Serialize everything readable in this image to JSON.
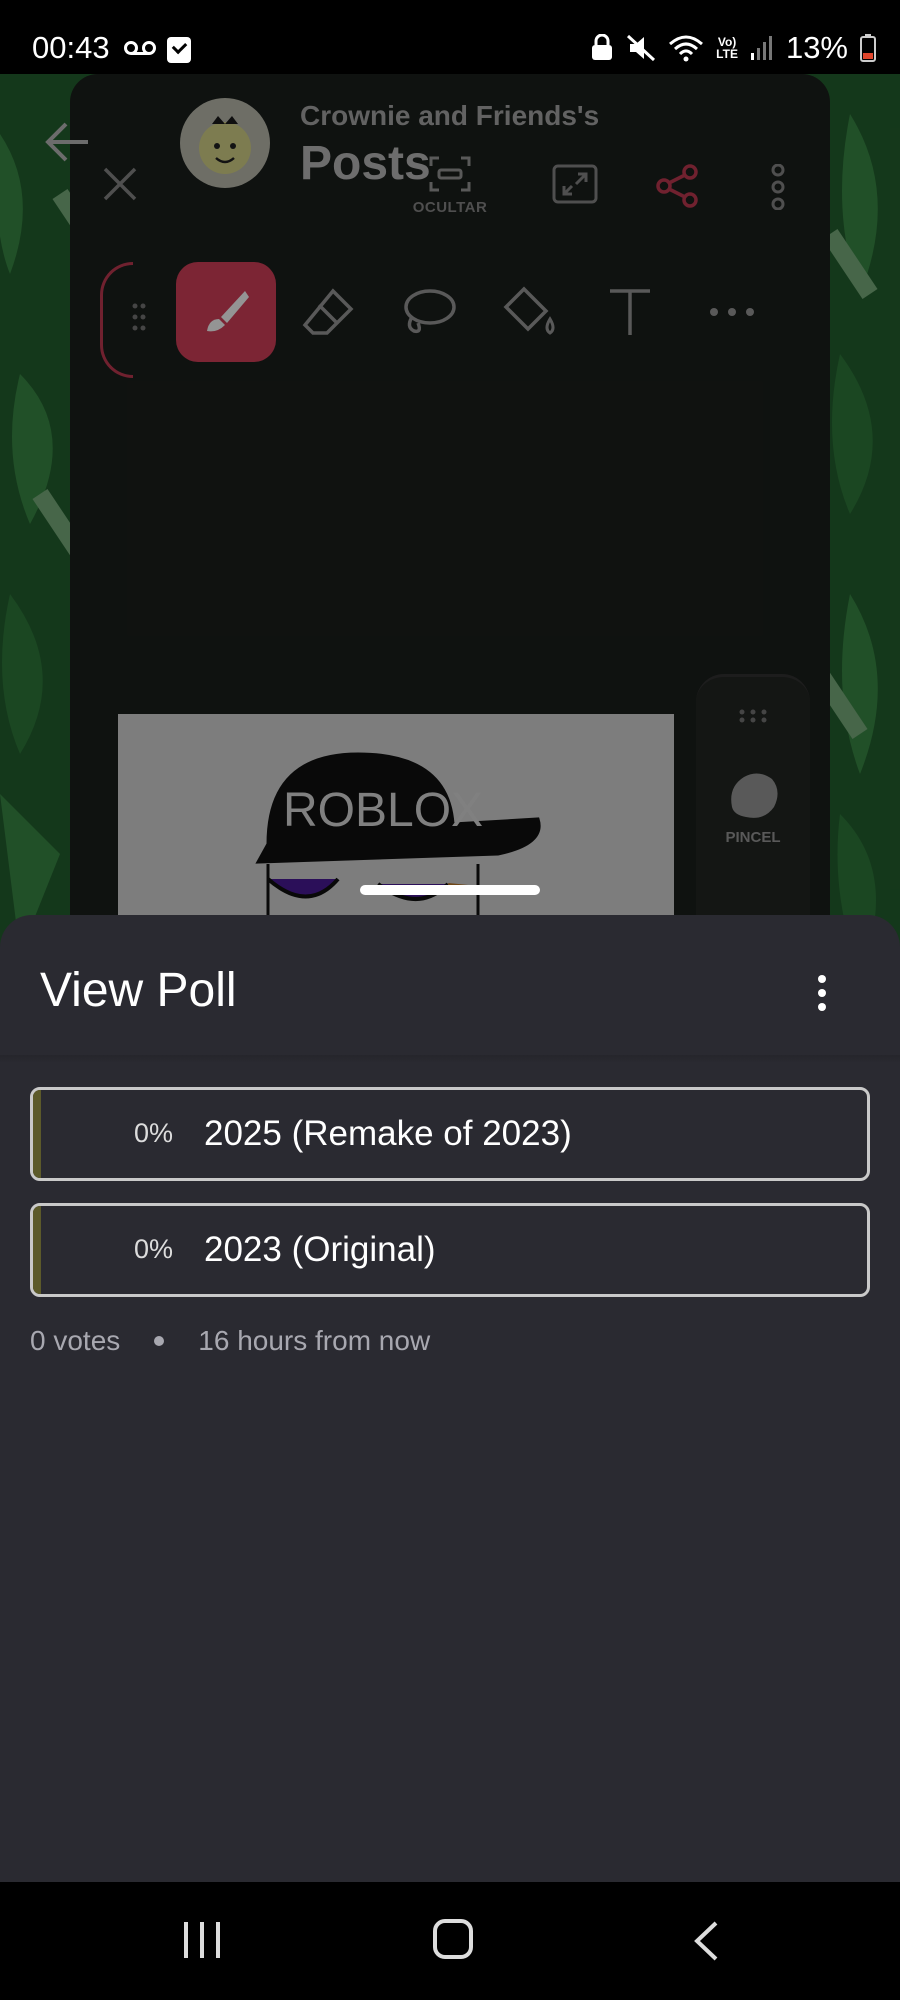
{
  "status_bar": {
    "time": "00:43",
    "battery_percent": "13%",
    "lte_label_top": "Vo)",
    "lte_label_bottom": "LTE"
  },
  "background_app": {
    "group_name": "Crownie and Friends's",
    "page_heading": "Posts",
    "hide_label": "OCULTAR",
    "side_tool_label": "PINCEL",
    "art_text": "ROBLOX",
    "colors": {
      "accent": "#d6415b",
      "leaf_green": "#1f5a2c"
    }
  },
  "poll_sheet": {
    "title": "View Poll",
    "options": [
      {
        "percent": "0%",
        "label": "2025 (Remake of 2023)",
        "fill": 0
      },
      {
        "percent": "0%",
        "label": "2023 (Original)",
        "fill": 0
      }
    ],
    "votes": "0 votes",
    "time_remaining": "16 hours from now",
    "colors": {
      "sheet_bg": "#2a2a31",
      "option_border": "#c9c9c9",
      "fill_bar": "#5c5a2a"
    }
  },
  "icons": {
    "status": [
      "voicemail-icon",
      "checkbox-icon",
      "lock-icon",
      "mute-icon",
      "wifi-icon",
      "signal-icon",
      "battery-icon"
    ],
    "nav": [
      "recent-apps-icon",
      "home-icon",
      "back-icon"
    ]
  }
}
